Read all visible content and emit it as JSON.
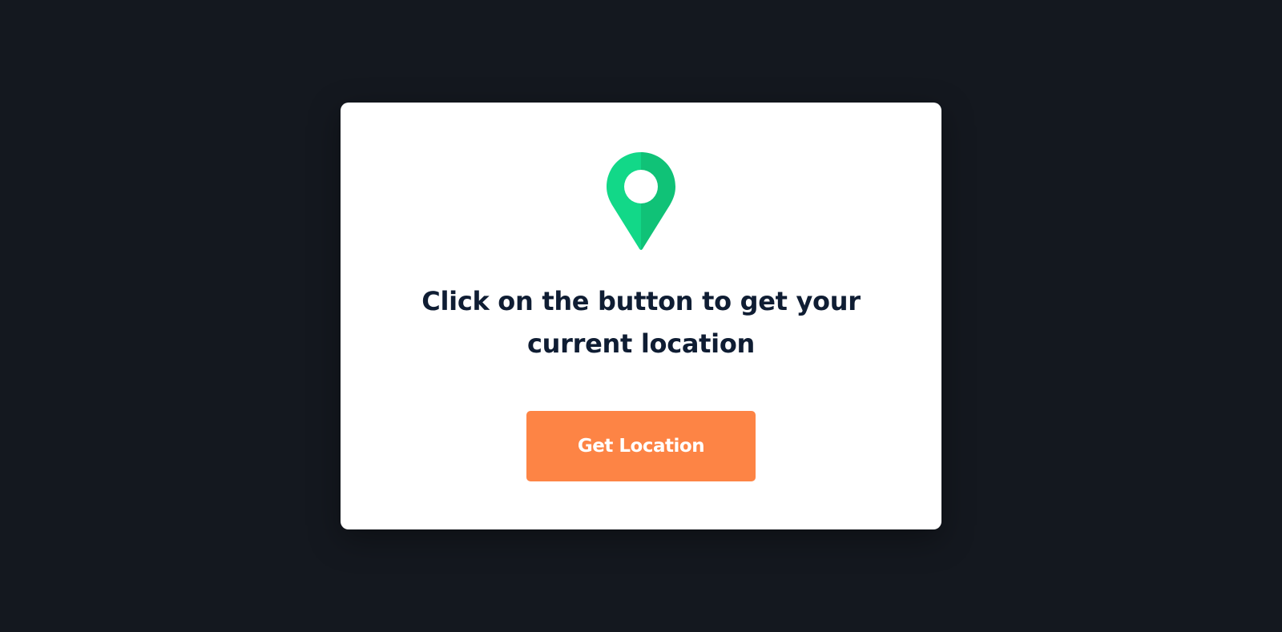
{
  "card": {
    "heading_line_1": "Click on the button to get your",
    "heading_line_2": "current location",
    "button_label": "Get Location",
    "icon": "map-pin-icon"
  },
  "colors": {
    "background": "#14181f",
    "card": "#ffffff",
    "pin_light": "#12d888",
    "pin_dark": "#10c277",
    "heading": "#0f1d33",
    "button": "#fd8445",
    "button_text": "#ffffff"
  }
}
